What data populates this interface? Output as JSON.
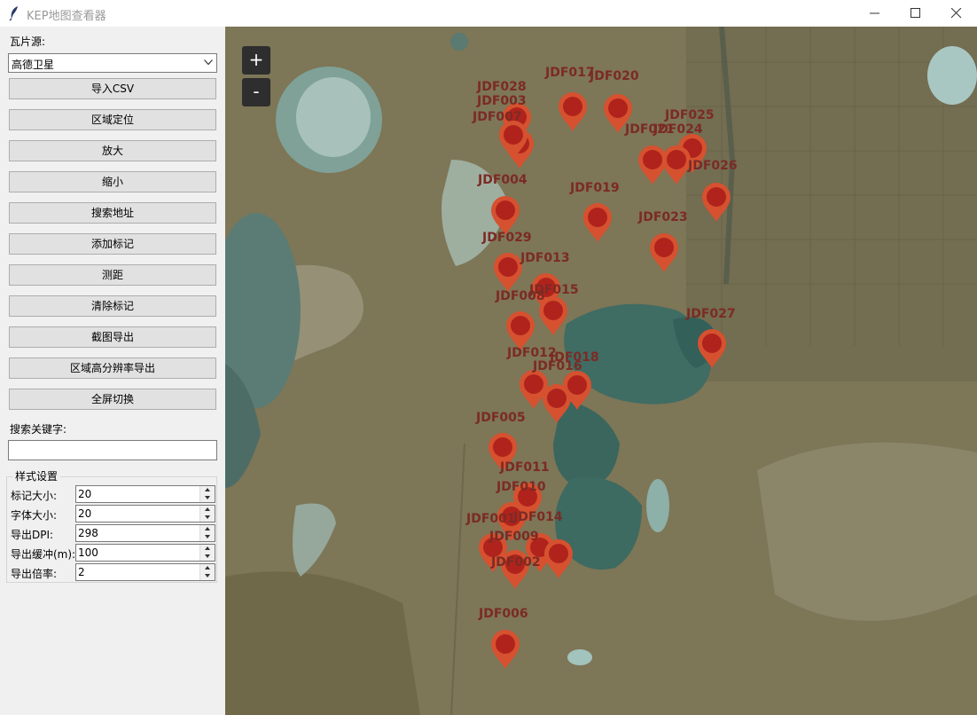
{
  "window": {
    "title": "KEP地图查看器"
  },
  "sidebar": {
    "tile_source_label": "瓦片源:",
    "tile_source_value": "高德卫星",
    "buttons": [
      "导入CSV",
      "区域定位",
      "放大",
      "缩小",
      "搜索地址",
      "添加标记",
      "测距",
      "清除标记",
      "截图导出",
      "区域高分辨率导出",
      "全屏切换"
    ],
    "search_label": "搜索关键字:",
    "search_value": "",
    "style_group_title": "样式设置",
    "settings": [
      {
        "label": "标记大小:",
        "value": "20"
      },
      {
        "label": "字体大小:",
        "value": "20"
      },
      {
        "label": "导出DPI:",
        "value": "298"
      },
      {
        "label": "导出缓冲(m):",
        "value": "100"
      },
      {
        "label": "导出倍率:",
        "value": "2"
      }
    ]
  },
  "map": {
    "zoom_in": "+",
    "zoom_out": "-",
    "colors": {
      "marker": "#d6512f",
      "marker_dot": "#b0231c",
      "label": "#7b2b24"
    },
    "markers": [
      "JDF028",
      "JDF003",
      "JDF007",
      "JDF017",
      "JDF020",
      "JDF025",
      "JDF024",
      "JDF021",
      "JDF026",
      "JDF004",
      "JDF019",
      "JDF023",
      "JDF029",
      "JDF013",
      "JDF015",
      "JDF008",
      "JDF027",
      "JDF012",
      "JDF018",
      "JDF016",
      "JDF005",
      "JDF011",
      "JDF010",
      "JDF014",
      "JDF001",
      "JDF009",
      "JDF002",
      "JDF006"
    ]
  }
}
